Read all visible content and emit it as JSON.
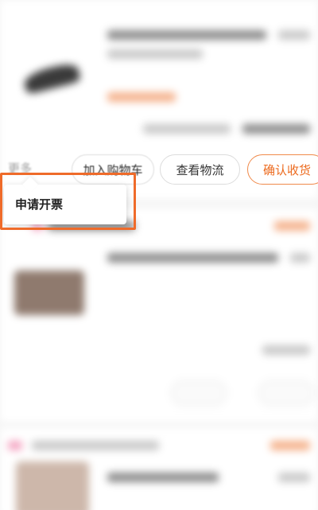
{
  "actions": {
    "more_label": "更多",
    "add_to_cart": "加入购物车",
    "view_logistics": "查看物流",
    "confirm_receipt": "确认收货"
  },
  "more_menu": {
    "items": [
      "申请开票"
    ]
  },
  "colors": {
    "accent": "#ec6a1e",
    "highlight": "#ef6b2a"
  },
  "icons": {
    "product_1": "shoe-thumbnail",
    "product_2": "product-thumbnail",
    "product_3": "product-thumbnail"
  }
}
